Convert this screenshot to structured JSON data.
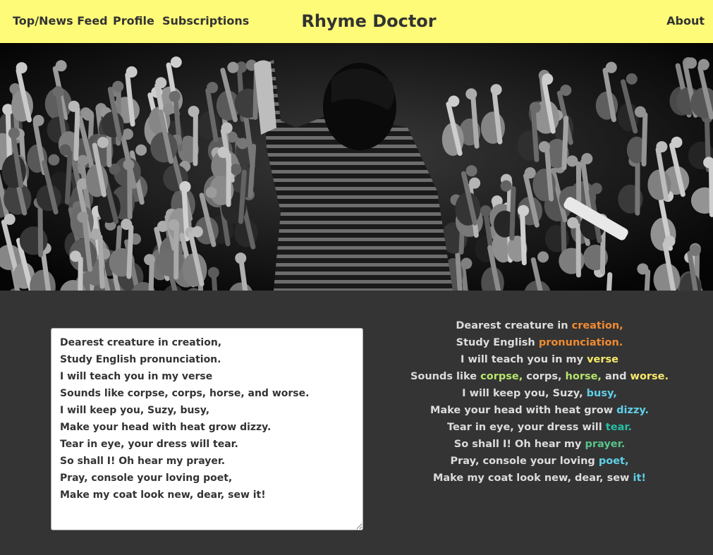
{
  "nav": {
    "cutoff_label": ":",
    "news_label": "Top/News Feed",
    "profile_label": "Profile",
    "subscriptions_label": "Subscriptions",
    "brand": "Rhyme Doctor",
    "about_label": "About"
  },
  "hero": {
    "image": "concert-crowd-photo"
  },
  "editor": {
    "value": "Dearest creature in creation,\nStudy English pronunciation.\nI will teach you in my verse\nSounds like corpse, corps, horse, and worse.\nI will keep you, Suzy, busy,\nMake your head with heat grow dizzy.\nTear in eye, your dress will tear.\nSo shall I! Oh hear my prayer.\nPray, console your loving poet,\nMake my coat look new, dear, sew it!"
  },
  "poem": {
    "lines": [
      [
        {
          "t": "Dearest creature in ",
          "c": ""
        },
        {
          "t": "creation,",
          "c": "orange"
        }
      ],
      [
        {
          "t": "Study English ",
          "c": ""
        },
        {
          "t": "pronunciation.",
          "c": "orange"
        }
      ],
      [
        {
          "t": "I will teach you in my ",
          "c": ""
        },
        {
          "t": "verse",
          "c": "yellow"
        }
      ],
      [
        {
          "t": "Sounds like ",
          "c": ""
        },
        {
          "t": "corpse,",
          "c": "lime"
        },
        {
          "t": " corps, ",
          "c": ""
        },
        {
          "t": "horse,",
          "c": "lime"
        },
        {
          "t": " and ",
          "c": ""
        },
        {
          "t": "worse.",
          "c": "yellow"
        }
      ],
      [
        {
          "t": "I will keep you, Suzy, ",
          "c": ""
        },
        {
          "t": "busy,",
          "c": "cyan"
        }
      ],
      [
        {
          "t": "Make your head with heat grow ",
          "c": ""
        },
        {
          "t": "dizzy.",
          "c": "cyan"
        }
      ],
      [
        {
          "t": "Tear in eye, your dress will ",
          "c": ""
        },
        {
          "t": "tear.",
          "c": "teal"
        }
      ],
      [
        {
          "t": "So shall I! Oh hear my ",
          "c": ""
        },
        {
          "t": "prayer.",
          "c": "green"
        }
      ],
      [
        {
          "t": "Pray, console your loving ",
          "c": ""
        },
        {
          "t": "poet,",
          "c": "cyan"
        }
      ],
      [
        {
          "t": "Make my coat look new, dear, sew ",
          "c": ""
        },
        {
          "t": "it!",
          "c": "cyan"
        }
      ]
    ]
  },
  "colors": {
    "navbar": "#fdfb78",
    "background": "#343434",
    "orange": "#f08a32",
    "lime": "#b6e36b",
    "yellow": "#f7ea6a",
    "cyan": "#5fd0e8",
    "teal": "#26c0a6",
    "green": "#57c48a"
  }
}
